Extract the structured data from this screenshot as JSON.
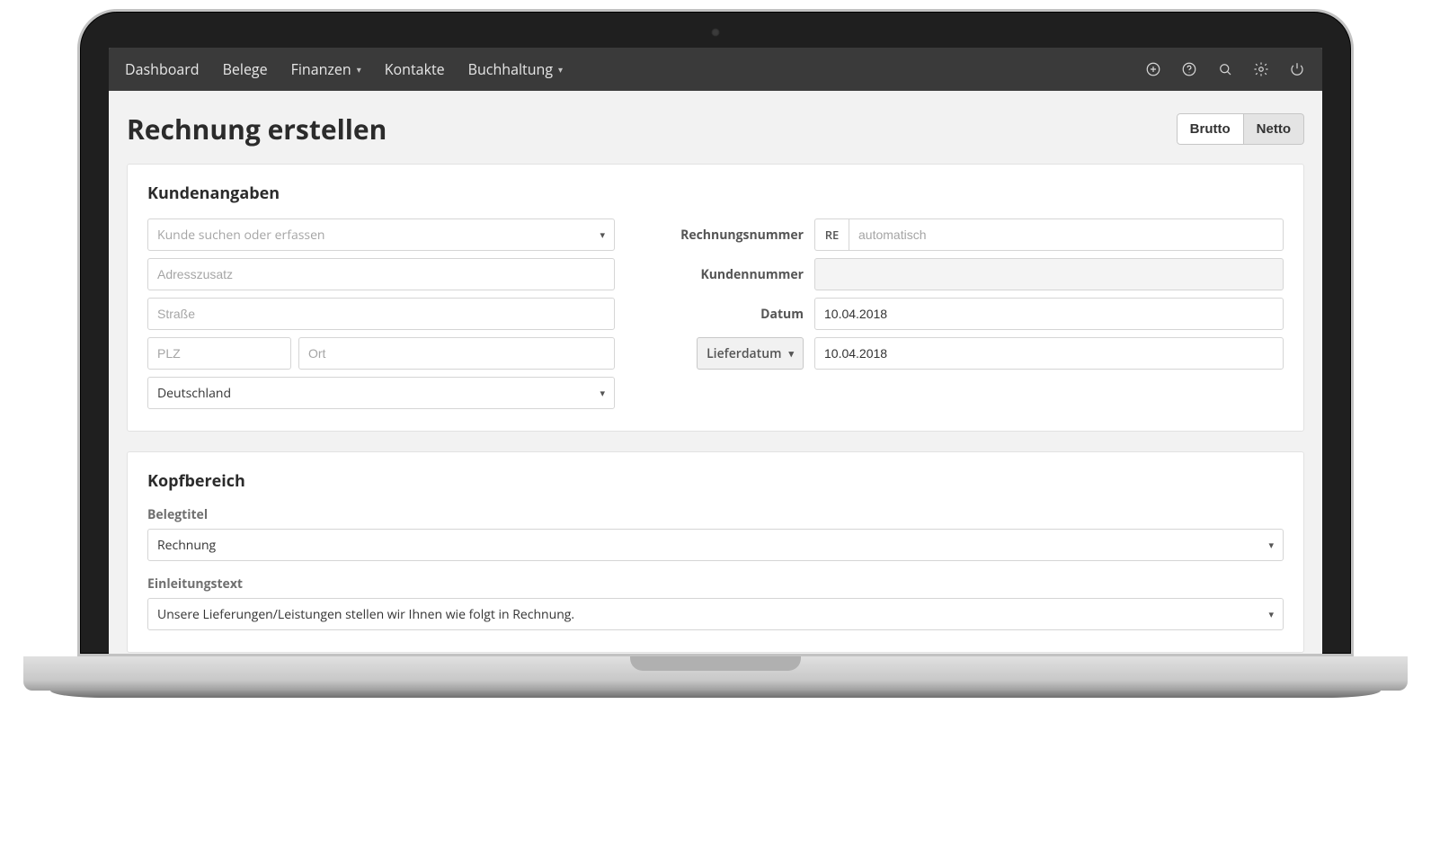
{
  "nav": {
    "items": [
      {
        "label": "Dashboard",
        "dropdown": false
      },
      {
        "label": "Belege",
        "dropdown": false
      },
      {
        "label": "Finanzen",
        "dropdown": true
      },
      {
        "label": "Kontakte",
        "dropdown": false
      },
      {
        "label": "Buchhaltung",
        "dropdown": true
      }
    ]
  },
  "page": {
    "title": "Rechnung erstellen",
    "toggle": {
      "brutto": "Brutto",
      "netto": "Netto",
      "active": "netto"
    }
  },
  "customer_section": {
    "heading": "Kundenangaben",
    "search_placeholder": "Kunde suchen oder erfassen",
    "address_addon_placeholder": "Adresszusatz",
    "street_placeholder": "Straße",
    "zip_placeholder": "PLZ",
    "city_placeholder": "Ort",
    "country_value": "Deutschland"
  },
  "meta": {
    "invoice_number_label": "Rechnungsnummer",
    "invoice_number_prefix": "RE",
    "invoice_number_placeholder": "automatisch",
    "customer_number_label": "Kundennummer",
    "customer_number_value": "",
    "date_label": "Datum",
    "date_value": "10.04.2018",
    "delivery_date_label": "Lieferdatum",
    "delivery_date_value": "10.04.2018"
  },
  "head_section": {
    "heading": "Kopfbereich",
    "title_label": "Belegtitel",
    "title_value": "Rechnung",
    "intro_label": "Einleitungstext",
    "intro_value": "Unsere Lieferungen/Leistungen stellen wir Ihnen wie folgt in Rechnung."
  }
}
